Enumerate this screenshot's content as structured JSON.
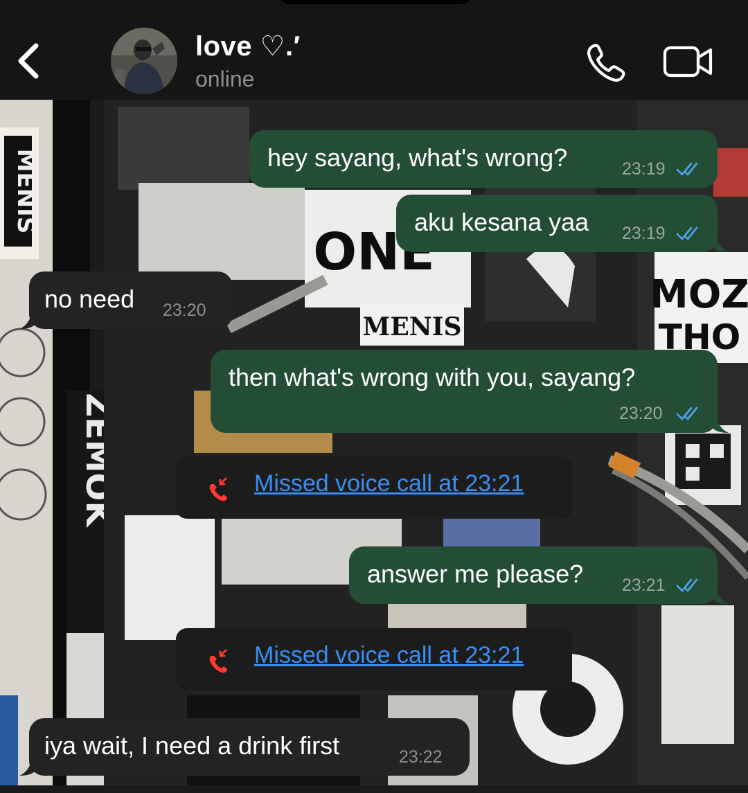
{
  "header": {
    "contact_name": "love ♡.′",
    "status": "online",
    "back_icon": "chevron-left-icon",
    "call_icon": "phone-icon",
    "video_icon": "video-camera-icon"
  },
  "colors": {
    "outgoing_bubble": "#244d35",
    "incoming_bubble": "#232323",
    "read_ticks": "#4ea3f1",
    "missed_call_red": "#ff3b30",
    "missed_call_link": "#3a8ef3"
  },
  "messages": [
    {
      "direction": "out",
      "text": "hey sayang, what's wrong?",
      "time": "23:19",
      "status": "read"
    },
    {
      "direction": "out",
      "text": "aku kesana yaa",
      "time": "23:19",
      "status": "read"
    },
    {
      "direction": "in",
      "text": "no need",
      "time": "23:20"
    },
    {
      "direction": "out",
      "text": "then what's wrong with you, sayang?",
      "time": "23:20",
      "status": "read"
    },
    {
      "direction": "system",
      "text": "Missed voice call at 23:21",
      "icon": "missed-call-icon"
    },
    {
      "direction": "out",
      "text": "answer me please?",
      "time": "23:21",
      "status": "read"
    },
    {
      "direction": "system",
      "text": "Missed voice call at 23:21",
      "icon": "missed-call-icon"
    },
    {
      "direction": "in",
      "text": "iya wait, I need a drink first",
      "time": "23:22"
    }
  ]
}
